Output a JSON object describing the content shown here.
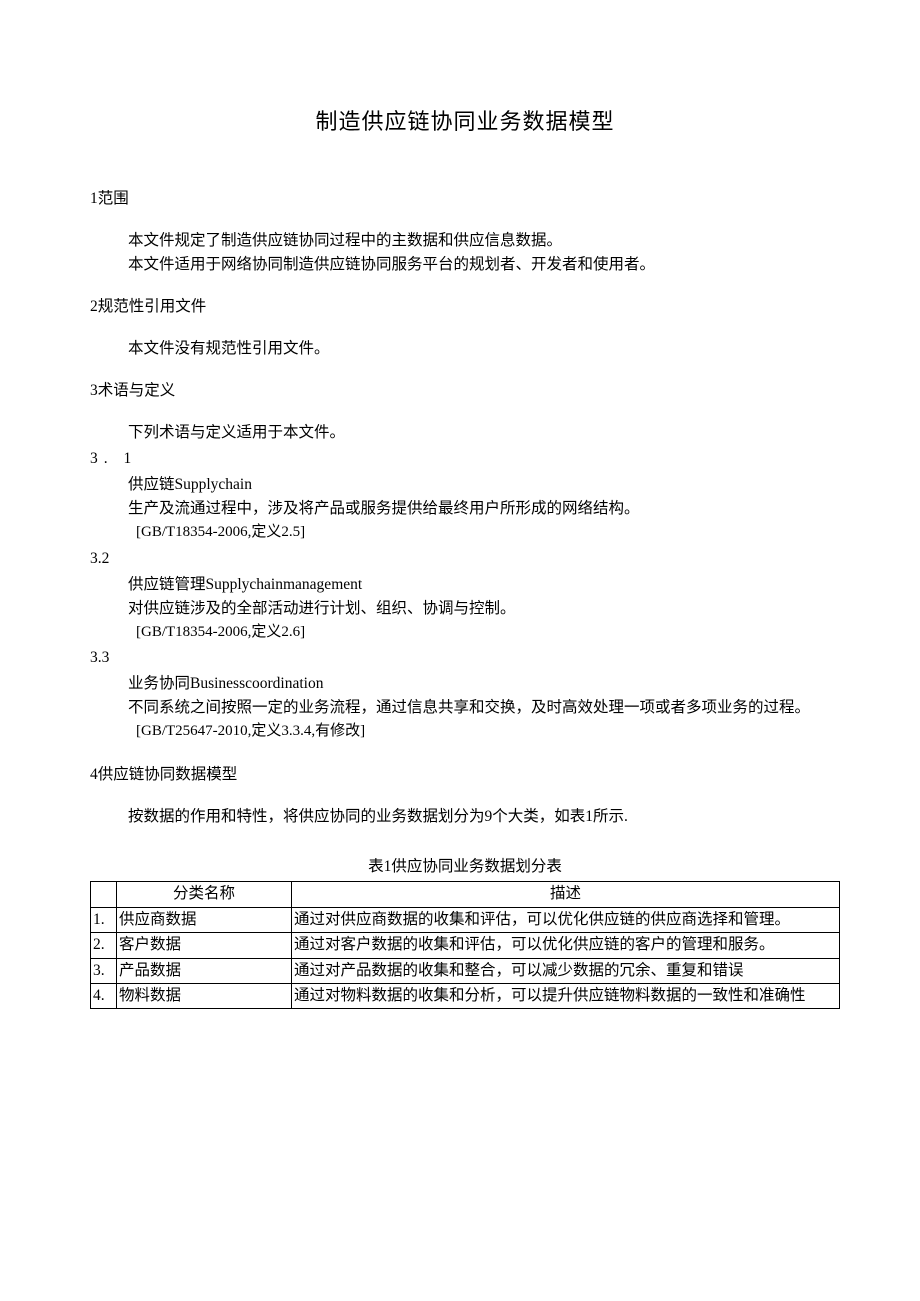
{
  "title": "制造供应链协同业务数据模型",
  "sections": {
    "s1": {
      "head": "1范围",
      "p1": "本文件规定了制造供应链协同过程中的主数据和供应信息数据。",
      "p2": "本文件适用于网络协同制造供应链协同服务平台的规划者、开发者和使用者。"
    },
    "s2": {
      "head": "2规范性引用文件",
      "p1": "本文件没有规范性引用文件。"
    },
    "s3": {
      "head": "3术语与定义",
      "p1": "下列术语与定义适用于本文件。",
      "t31num": "3.  1",
      "t31term": "供应链Supplychain",
      "t31def": "生产及流通过程中，涉及将产品或服务提供给最终用户所形成的网络结构。",
      "t31ref": "[GB/T18354-2006,定义2.5]",
      "t32num": "3.2",
      "t32term": "供应链管理Supplychainmanagement",
      "t32def": "对供应链涉及的全部活动进行计划、组织、协调与控制。",
      "t32ref": "[GB/T18354-2006,定义2.6]",
      "t33num": "3.3",
      "t33term": "业务协同Businesscoordination",
      "t33def": "不同系统之间按照一定的业务流程，通过信息共享和交换，及时高效处理一项或者多项业务的过程。",
      "t33ref": "[GB/T25647-2010,定义3.3.4,有修改]"
    },
    "s4": {
      "head": "4供应链协同数据模型",
      "p1": "按数据的作用和特性，将供应协同的业务数据划分为9个大类，如表1所示."
    }
  },
  "table": {
    "caption": "表1供应协同业务数据划分表",
    "headers": {
      "name": "分类名称",
      "desc": "描述"
    },
    "rows": [
      {
        "num": "1.",
        "name": "供应商数据",
        "desc": "通过对供应商数据的收集和评估，可以优化供应链的供应商选择和管理。"
      },
      {
        "num": "2.",
        "name": "客户数据",
        "desc": "通过对客户数据的收集和评估，可以优化供应链的客户的管理和服务。"
      },
      {
        "num": "3.",
        "name": "产品数据",
        "desc": "通过对产品数据的收集和整合，可以减少数据的冗余、重复和错误"
      },
      {
        "num": "4.",
        "name": "物料数据",
        "desc": "通过对物料数据的收集和分析，可以提升供应链物料数据的一致性和准确性"
      }
    ]
  }
}
